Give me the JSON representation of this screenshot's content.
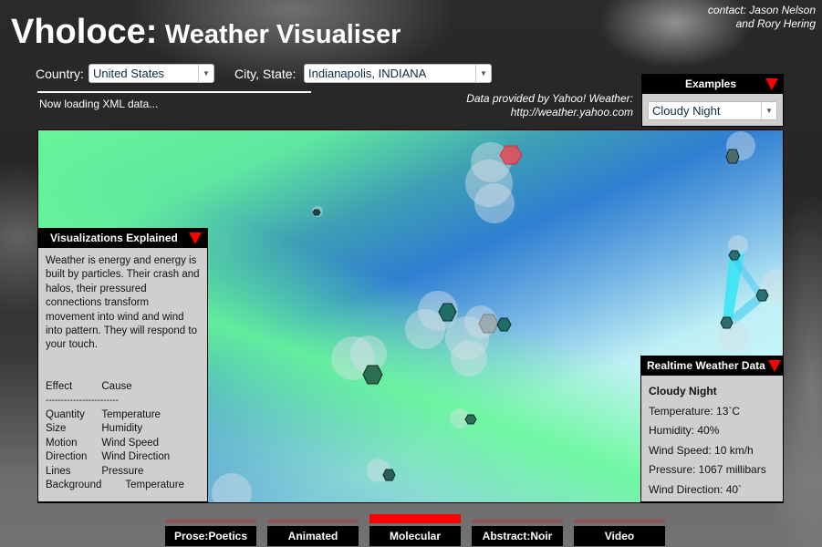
{
  "header": {
    "title_main": "Vholoce:",
    "title_sub": "Weather Visualiser",
    "contact_line1": "contact: Jason Nelson",
    "contact_line2": "and Rory Hering"
  },
  "controls": {
    "country_label": "Country:",
    "country_value": "United States",
    "city_label": "City, State:",
    "city_value": "Indianapolis, INDIANA",
    "status": "Now loading XML data...",
    "credit_line1": "Data provided by Yahoo! Weather:",
    "credit_line2": "http://weather.yahoo.com"
  },
  "examples": {
    "title": "Examples",
    "selected": "Cloudy Night"
  },
  "explain": {
    "title": "Visualizations Explained",
    "text": "Weather is energy and energy is built by particles. Their crash and halos, their pressured connections transform movement into wind and wind into pattern. They will respond to your touch.",
    "col_effect": "Effect",
    "col_cause": "Cause",
    "separator": "------------------------",
    "rows": [
      {
        "effect": "Quantity",
        "cause": "Temperature"
      },
      {
        "effect": "Size",
        "cause": "Humidity"
      },
      {
        "effect": "Motion",
        "cause": "Wind Speed"
      },
      {
        "effect": "Direction",
        "cause": "Wind Direction"
      },
      {
        "effect": "Lines",
        "cause": "Pressure"
      },
      {
        "effect": "Background",
        "cause": "Temperature"
      }
    ]
  },
  "realtime": {
    "title": "Realtime Weather Data",
    "condition": "Cloudy Night",
    "temperature": "Temperature: 13`C",
    "humidity": "Humidity: 40%",
    "wind_speed": "Wind Speed: 10 km/h",
    "pressure": "Pressure: 1067 millibars",
    "wind_direction": "Wind Direction: 40`"
  },
  "nav": {
    "items": [
      {
        "label": "Prose:Poetics",
        "active": false
      },
      {
        "label": "Animated",
        "active": false
      },
      {
        "label": "Molecular",
        "active": true
      },
      {
        "label": "Abstract:Noir",
        "active": false
      },
      {
        "label": "Video",
        "active": false
      }
    ]
  },
  "colors": {
    "accent_red": "#ff0000",
    "particle_dark": "#2e6e66",
    "particle_hot": "#e04050",
    "connection": "#35e0f0"
  }
}
